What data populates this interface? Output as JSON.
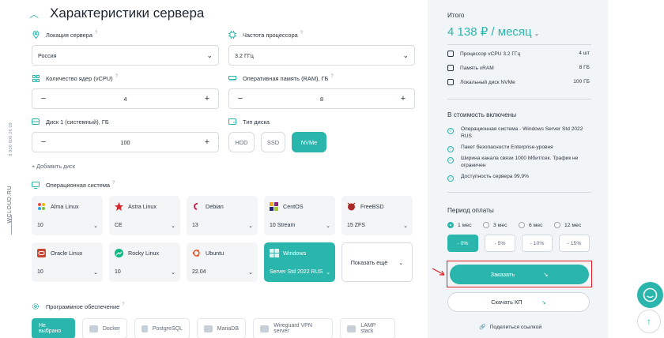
{
  "rail": {
    "phone": "8 800 600 26 09",
    "brand": "WCLOUD.RU"
  },
  "title": "Характеристики сервера",
  "fields": {
    "location": {
      "label": "Локация сервера",
      "value": "Россия"
    },
    "cpu_freq": {
      "label": "Частота процессора",
      "value": "3.2 ГГц"
    },
    "cores": {
      "label": "Количество ядер (vCPU)",
      "value": "4"
    },
    "ram": {
      "label": "Оперативная память (RAM), ГБ",
      "value": "8"
    },
    "disk1": {
      "label": "Диск 1 (системный), ГБ",
      "value": "100"
    },
    "disk_type": {
      "label": "Тип диска",
      "options": [
        "HDD",
        "SSD",
        "NVMe"
      ],
      "selected": "NVMe"
    }
  },
  "add_disk": "+ Добавить диск",
  "os": {
    "label": "Операционная система",
    "cards": [
      {
        "name": "Alma Linux",
        "version": "10"
      },
      {
        "name": "Astra Linux",
        "version": "CE"
      },
      {
        "name": "Debian",
        "version": "13"
      },
      {
        "name": "CentOS",
        "version": "10 Stream"
      },
      {
        "name": "FreeBSD",
        "version": "15 ZFS"
      },
      {
        "name": "Oracle Linux",
        "version": "10"
      },
      {
        "name": "Rocky Linux",
        "version": "10"
      },
      {
        "name": "Ubuntu",
        "version": "22.04"
      },
      {
        "name": "Windows",
        "version": "Server Std 2022 RUS"
      }
    ],
    "more": "Показать ещё"
  },
  "software": {
    "label": "Программное обеспечение",
    "items": [
      "Не выбрано",
      "Docker",
      "PostgreSQL",
      "MariaDB",
      "Wireguard VPN server",
      "LAMP stack"
    ]
  },
  "summary": {
    "heading": "Итого",
    "price": "4 138 ₽ / месяц",
    "specs": [
      {
        "k": "Процессор vCPU 3.2 ГГц",
        "v": "4 шт"
      },
      {
        "k": "Память vRAM",
        "v": "8 ГБ"
      },
      {
        "k": "Локальный диск NVMe",
        "v": "100 ГБ"
      }
    ],
    "included_heading": "В стоимость включены",
    "included": [
      "Операционная система - Windows Server Std 2022 RUS",
      "Пакет безопасности Enterprise-уровня",
      "Ширина канала связи 1000 Мбит/сек. Трафик не ограничен",
      "Доступность сервера 99,9%"
    ],
    "period_heading": "Период оплаты",
    "periods": [
      "1 мес",
      "3 мес",
      "6 мес",
      "12 мес"
    ],
    "discounts": [
      "- 0%",
      "- 5%",
      "- 10%",
      "- 15%"
    ],
    "order": "Заказать",
    "kp": "Скачать КП",
    "share": "Поделиться ссылкой"
  },
  "colors": {
    "accent": "#2bb6ad",
    "highlight": "#e01b24",
    "panel": "#f2f5f7"
  }
}
